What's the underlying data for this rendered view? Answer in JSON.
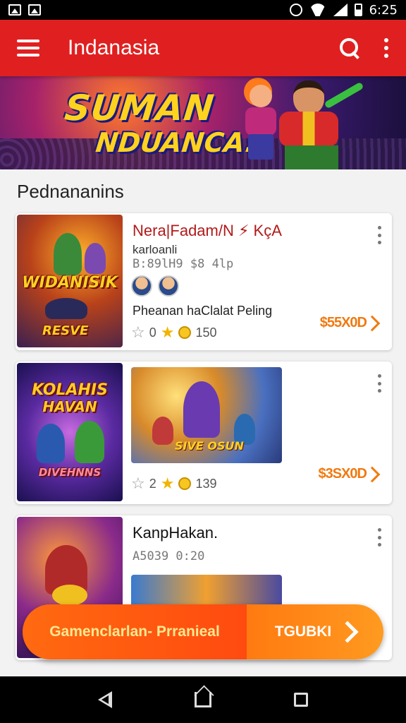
{
  "status_bar": {
    "time": "6:25"
  },
  "app_bar": {
    "title": "Indanasia"
  },
  "banner": {
    "title": "SUMAN",
    "subtitle": "NDUANCA!"
  },
  "section": {
    "title": "Pednananins"
  },
  "cards": [
    {
      "thumb_title": "WIDANISIK",
      "thumb_sub": "RESVE",
      "title": "Nera|Fadam/N ⚡ KçA",
      "subtitle": "karloanli",
      "meta": "B:89lH9  $8 4lp",
      "description": "Pheanan haClalat Peling",
      "rating": "0",
      "count": "150",
      "price": "$55X0D"
    },
    {
      "thumb_title": "KOLAHIS",
      "thumb_sub": "HAVAN",
      "thumb_caption": "DIVEHNNS",
      "media_label": "SIVE OSUN",
      "rating": "2",
      "count": "139",
      "price": "$3SX0D"
    },
    {
      "title": "KanpHakan.",
      "meta": "A5039 0:20"
    }
  ],
  "cta": {
    "left_label": "Gamenclarlan- Prranieal",
    "right_label": "TGUBKI"
  },
  "colors": {
    "primary": "#e02020",
    "accent": "#f07a10",
    "star": "#f0b400"
  }
}
